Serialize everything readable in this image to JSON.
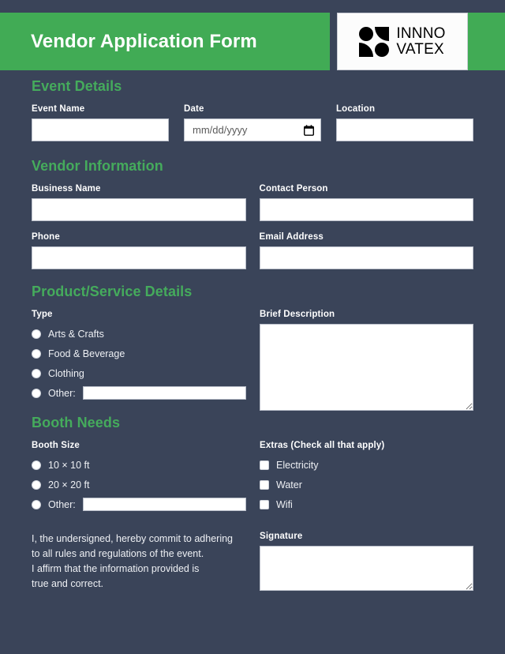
{
  "theme": {
    "background": "#3a4459",
    "accent_green": "#41ab55",
    "heading_green": "#45ab5c",
    "field_white": "#ffffff"
  },
  "header": {
    "title": "Vendor Application Form",
    "logo": {
      "mark_name": "innovatex-logo-mark",
      "line1": "INNNO",
      "line2": "VATEX"
    }
  },
  "sections": {
    "event_details": {
      "title": "Event Details",
      "fields": {
        "event_name": {
          "label": "Event Name",
          "value": ""
        },
        "date": {
          "label": "Date",
          "value": "",
          "placeholder": "mm/dd/yyyy"
        },
        "location": {
          "label": "Location",
          "value": ""
        }
      }
    },
    "vendor_information": {
      "title": "Vendor Information",
      "fields": {
        "business_name": {
          "label": "Business Name",
          "value": ""
        },
        "contact_person": {
          "label": "Contact Person",
          "value": ""
        },
        "phone": {
          "label": "Phone",
          "value": ""
        },
        "email_address": {
          "label": "Email Address",
          "value": ""
        }
      }
    },
    "product_service_details": {
      "title": "Product/Service Details",
      "type": {
        "label": "Type",
        "options": [
          {
            "label": "Arts & Crafts",
            "checked": false
          },
          {
            "label": "Food & Beverage",
            "checked": false
          },
          {
            "label": "Clothing",
            "checked": false
          },
          {
            "label": "Other:",
            "checked": false,
            "has_input": true,
            "value": ""
          }
        ]
      },
      "brief_description": {
        "label": "Brief Description",
        "value": ""
      }
    },
    "booth_needs": {
      "title": "Booth Needs",
      "booth_size": {
        "label": "Booth Size",
        "options": [
          {
            "label": "10 × 10 ft",
            "checked": false
          },
          {
            "label": "20 × 20 ft",
            "checked": false
          },
          {
            "label": "Other:",
            "checked": false,
            "has_input": true,
            "value": ""
          }
        ]
      },
      "extras": {
        "label": "Extras (Check all that apply)",
        "options": [
          {
            "label": "Electricity",
            "checked": false
          },
          {
            "label": "Water",
            "checked": false
          },
          {
            "label": "Wifi",
            "checked": false
          }
        ]
      }
    },
    "declaration": {
      "text_lines": [
        "I, the undersigned, hereby commit to adhering",
        "to all rules and regulations of the event.",
        "I affirm that the information provided is",
        "true and correct."
      ],
      "signature": {
        "label": "Signature",
        "value": ""
      }
    }
  }
}
